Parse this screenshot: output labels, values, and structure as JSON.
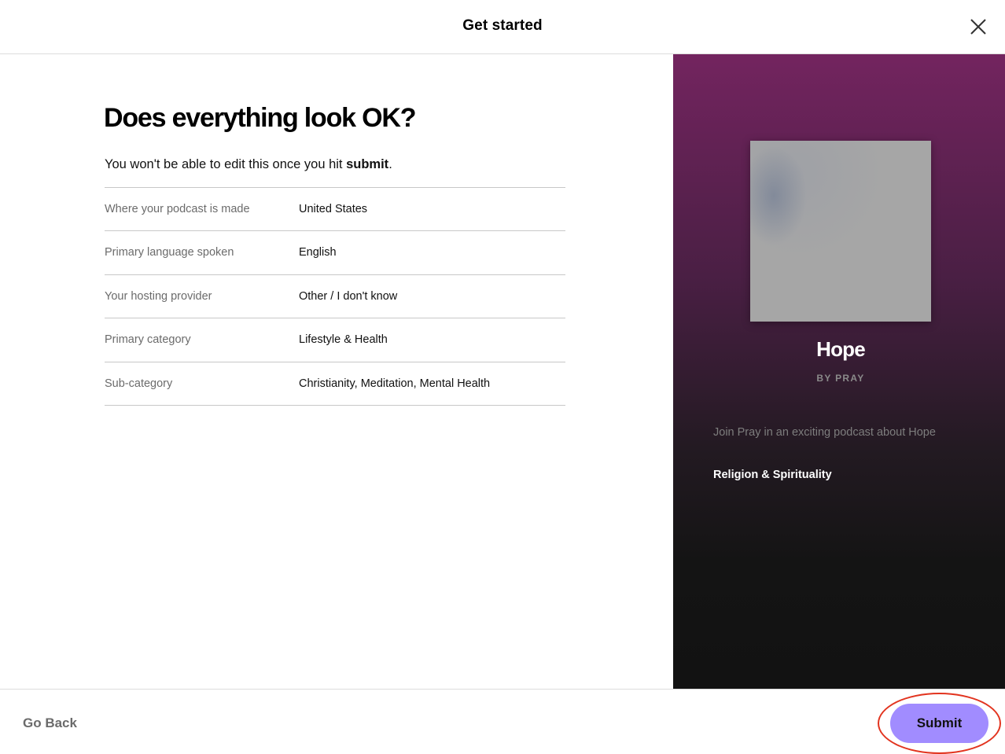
{
  "header": {
    "title": "Get started"
  },
  "main": {
    "heading": "Does everything look OK?",
    "subtext_prefix": "You won't be able to edit this once you hit ",
    "subtext_bold": "submit",
    "subtext_suffix": ".",
    "rows": [
      {
        "label": "Where your podcast is made",
        "value": "United States"
      },
      {
        "label": "Primary language spoken",
        "value": "English"
      },
      {
        "label": "Your hosting provider",
        "value": "Other / I don't know"
      },
      {
        "label": "Primary category",
        "value": "Lifestyle & Health"
      },
      {
        "label": "Sub-category",
        "value": "Christianity, Meditation, Mental Health"
      }
    ]
  },
  "preview": {
    "title": "Hope",
    "author": "BY PRAY",
    "description": "Join Pray in an exciting podcast about Hope",
    "category": "Religion & Spirituality"
  },
  "footer": {
    "back_label": "Go Back",
    "submit_label": "Submit"
  },
  "colors": {
    "submit_button": "#a18cff",
    "highlight_ring": "#e2341f",
    "preview_gradient_top": "#73245f",
    "preview_gradient_bottom": "#121212"
  },
  "icons": {
    "close": "close-icon"
  }
}
